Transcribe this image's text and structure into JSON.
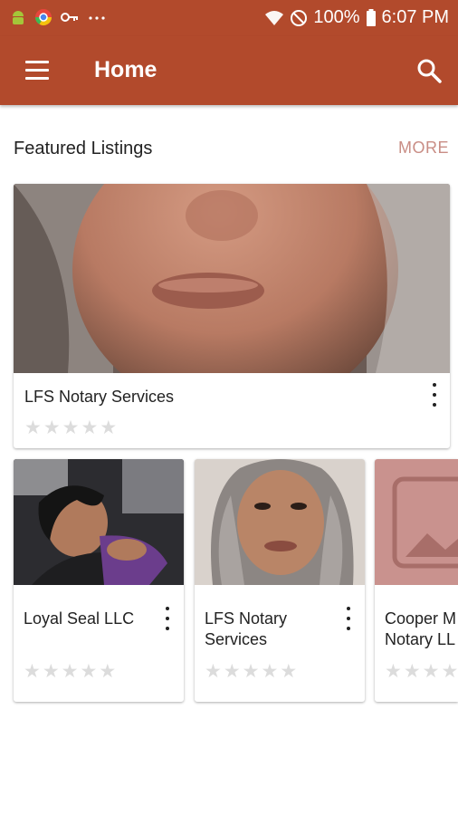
{
  "status_bar": {
    "battery": "100%",
    "time": "6:07 PM",
    "left_icons": [
      "android-icon",
      "chrome-icon",
      "key-icon",
      "more-dots-icon"
    ],
    "right_icons": [
      "wifi-icon",
      "do-not-disturb-icon",
      "battery-icon"
    ]
  },
  "app_bar": {
    "title": "Home",
    "color": "#b24a2c",
    "icons": [
      "menu-icon",
      "search-icon"
    ]
  },
  "featured": {
    "title": "Featured Listings",
    "more_label": "MORE",
    "main_listing": {
      "name": "LFS Notary Services",
      "rating": 0,
      "max_rating": 5
    },
    "listings": [
      {
        "name": "Loyal Seal LLC",
        "rating": 0,
        "max_rating": 5
      },
      {
        "name": "LFS Notary Services",
        "rating": 0,
        "max_rating": 5
      },
      {
        "name": "Cooper M Notary LL",
        "rating": 0,
        "max_rating": 5
      }
    ]
  },
  "colors": {
    "accent": "#b24a2c",
    "more_text": "#c98d85",
    "placeholder": "#c9928e",
    "star_empty": "#dcdcdc"
  }
}
